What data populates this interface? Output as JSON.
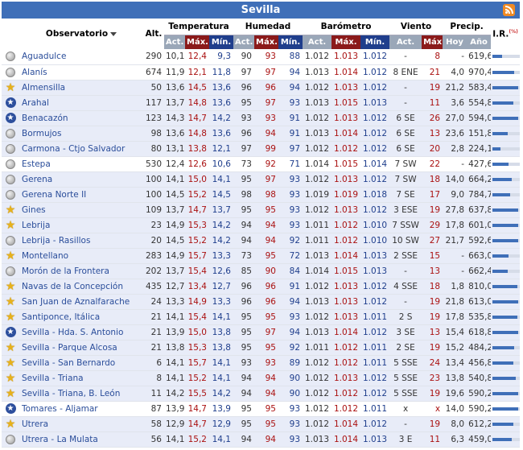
{
  "title": "Sevilla",
  "icons": {
    "rss": "rss-icon",
    "sort": "sort-down-icon"
  },
  "headers": {
    "observatorio": "Observatorio",
    "alt": "Alt.",
    "temperatura": "Temperatura",
    "humedad": "Humedad",
    "barometro": "Barómetro",
    "viento": "Viento",
    "precip": "Precip.",
    "ir": "I.R.",
    "ir_sup": "(%)",
    "act": "Act.",
    "max": "Máx.",
    "min": "Mín.",
    "hoy": "Hoy",
    "ano": "Año"
  },
  "colors": {
    "title_bg": "#3f6fb8",
    "max_text": "#a11111",
    "min_text": "#1f3e8c",
    "link": "#2a4d9a"
  },
  "rows": [
    {
      "icon": "circle",
      "name": "Aguadulce",
      "alt": "290",
      "t_act": "10,1",
      "t_max": "12,4",
      "t_min": "9,3",
      "h_act": "90",
      "h_max": "93",
      "h_min": "88",
      "b_act": "1.012",
      "b_max": "1.013",
      "b_min": "1.012",
      "w_act": "-",
      "w_max": "8",
      "p_hoy": "-",
      "p_ano": "619,6",
      "ir": 0.35
    },
    {
      "icon": "circle",
      "name": "Alanís",
      "alt": "674",
      "t_act": "11,9",
      "t_max": "12,1",
      "t_min": "11,8",
      "h_act": "97",
      "h_max": "97",
      "h_min": "94",
      "b_act": "1.013",
      "b_max": "1.014",
      "b_min": "1.012",
      "w_act": "8 ENE",
      "w_max": "21",
      "p_hoy": "4,0",
      "p_ano": "970,4",
      "ir": 0.8
    },
    {
      "icon": "star",
      "name": "Almensilla",
      "alt": "50",
      "t_act": "13,6",
      "t_max": "14,5",
      "t_min": "13,6",
      "h_act": "96",
      "h_max": "96",
      "h_min": "94",
      "b_act": "1.012",
      "b_max": "1.013",
      "b_min": "1.012",
      "w_act": "-",
      "w_max": "19",
      "p_hoy": "21,2",
      "p_ano": "583,4",
      "ir": 0.95
    },
    {
      "icon": "starblue",
      "name": "Arahal",
      "alt": "117",
      "t_act": "13,7",
      "t_max": "14,8",
      "t_min": "13,6",
      "h_act": "95",
      "h_max": "97",
      "h_min": "93",
      "b_act": "1.013",
      "b_max": "1.015",
      "b_min": "1.013",
      "w_act": "-",
      "w_max": "11",
      "p_hoy": "3,6",
      "p_ano": "554,8",
      "ir": 0.75
    },
    {
      "icon": "starblue",
      "name": "Benacazón",
      "alt": "123",
      "t_act": "14,3",
      "t_max": "14,7",
      "t_min": "14,2",
      "h_act": "93",
      "h_max": "93",
      "h_min": "91",
      "b_act": "1.012",
      "b_max": "1.013",
      "b_min": "1.012",
      "w_act": "6 SE",
      "w_max": "26",
      "p_hoy": "27,0",
      "p_ano": "594,0",
      "ir": 0.95
    },
    {
      "icon": "circle",
      "name": "Bormujos",
      "alt": "98",
      "t_act": "13,6",
      "t_max": "14,8",
      "t_min": "13,6",
      "h_act": "96",
      "h_max": "94",
      "h_min": "91",
      "b_act": "1.013",
      "b_max": "1.014",
      "b_min": "1.012",
      "w_act": "6 SE",
      "w_max": "13",
      "p_hoy": "23,6",
      "p_ano": "151,8",
      "ir": 0.55
    },
    {
      "icon": "circle",
      "name": "Carmona - Ctjo Salvador",
      "alt": "80",
      "t_act": "13,1",
      "t_max": "13,8",
      "t_min": "12,1",
      "h_act": "97",
      "h_max": "99",
      "h_min": "97",
      "b_act": "1.012",
      "b_max": "1.012",
      "b_min": "1.012",
      "w_act": "6 SE",
      "w_max": "20",
      "p_hoy": "2,8",
      "p_ano": "224,1",
      "ir": 0.3
    },
    {
      "icon": "circle",
      "name": "Estepa",
      "alt": "530",
      "t_act": "12,4",
      "t_max": "12,6",
      "t_min": "10,6",
      "h_act": "73",
      "h_max": "92",
      "h_min": "71",
      "b_act": "1.014",
      "b_max": "1.015",
      "b_min": "1.014",
      "w_act": "7 SW",
      "w_max": "22",
      "p_hoy": "-",
      "p_ano": "427,6",
      "ir": 0.6
    },
    {
      "icon": "circle",
      "name": "Gerena",
      "alt": "100",
      "t_act": "14,1",
      "t_max": "15,0",
      "t_min": "14,1",
      "h_act": "95",
      "h_max": "97",
      "h_min": "93",
      "b_act": "1.012",
      "b_max": "1.013",
      "b_min": "1.012",
      "w_act": "7 SW",
      "w_max": "18",
      "p_hoy": "14,0",
      "p_ano": "664,2",
      "ir": 0.7
    },
    {
      "icon": "circle",
      "name": "Gerena Norte II",
      "alt": "100",
      "t_act": "14,5",
      "t_max": "15,2",
      "t_min": "14,5",
      "h_act": "98",
      "h_max": "98",
      "h_min": "93",
      "b_act": "1.019",
      "b_max": "1.019",
      "b_min": "1.018",
      "w_act": "7 SE",
      "w_max": "17",
      "p_hoy": "9,0",
      "p_ano": "784,7",
      "ir": 0.65
    },
    {
      "icon": "star",
      "name": "Gines",
      "alt": "109",
      "t_act": "13,7",
      "t_max": "14,7",
      "t_min": "13,7",
      "h_act": "95",
      "h_max": "95",
      "h_min": "93",
      "b_act": "1.012",
      "b_max": "1.013",
      "b_min": "1.012",
      "w_act": "3 ESE",
      "w_max": "19",
      "p_hoy": "27,8",
      "p_ano": "637,8",
      "ir": 0.95
    },
    {
      "icon": "star",
      "name": "Lebrija",
      "alt": "23",
      "t_act": "14,9",
      "t_max": "15,3",
      "t_min": "14,2",
      "h_act": "94",
      "h_max": "94",
      "h_min": "93",
      "b_act": "1.011",
      "b_max": "1.012",
      "b_min": "1.010",
      "w_act": "7 SSW",
      "w_max": "29",
      "p_hoy": "17,8",
      "p_ano": "601,0",
      "ir": 0.95
    },
    {
      "icon": "circle",
      "name": "Lebrija - Rasillos",
      "alt": "20",
      "t_act": "14,5",
      "t_max": "15,2",
      "t_min": "14,2",
      "h_act": "94",
      "h_max": "94",
      "h_min": "92",
      "b_act": "1.011",
      "b_max": "1.012",
      "b_min": "1.010",
      "w_act": "10 SW",
      "w_max": "27",
      "p_hoy": "21,7",
      "p_ano": "592,6",
      "ir": 0.95
    },
    {
      "icon": "star",
      "name": "Montellano",
      "alt": "283",
      "t_act": "14,9",
      "t_max": "15,7",
      "t_min": "13,3",
      "h_act": "73",
      "h_max": "95",
      "h_min": "72",
      "b_act": "1.013",
      "b_max": "1.014",
      "b_min": "1.013",
      "w_act": "2 SSE",
      "w_max": "15",
      "p_hoy": "-",
      "p_ano": "663,0",
      "ir": 0.6
    },
    {
      "icon": "circle",
      "name": "Morón de la Frontera",
      "alt": "202",
      "t_act": "13,7",
      "t_max": "15,4",
      "t_min": "12,6",
      "h_act": "85",
      "h_max": "90",
      "h_min": "84",
      "b_act": "1.014",
      "b_max": "1.015",
      "b_min": "1.013",
      "w_act": "-",
      "w_max": "13",
      "p_hoy": "-",
      "p_ano": "662,4",
      "ir": 0.55
    },
    {
      "icon": "star",
      "name": "Navas de la Concepción",
      "alt": "435",
      "t_act": "12,7",
      "t_max": "13,4",
      "t_min": "12,7",
      "h_act": "96",
      "h_max": "96",
      "h_min": "91",
      "b_act": "1.012",
      "b_max": "1.013",
      "b_min": "1.012",
      "w_act": "4 SSE",
      "w_max": "18",
      "p_hoy": "1,8",
      "p_ano": "810,0",
      "ir": 0.9
    },
    {
      "icon": "star",
      "name": "San Juan de Aznalfarache",
      "alt": "24",
      "t_act": "13,3",
      "t_max": "14,9",
      "t_min": "13,3",
      "h_act": "96",
      "h_max": "96",
      "h_min": "94",
      "b_act": "1.013",
      "b_max": "1.013",
      "b_min": "1.012",
      "w_act": "-",
      "w_max": "19",
      "p_hoy": "21,8",
      "p_ano": "613,0",
      "ir": 0.95
    },
    {
      "icon": "star",
      "name": "Santiponce, Itálica",
      "alt": "21",
      "t_act": "14,1",
      "t_max": "15,4",
      "t_min": "14,1",
      "h_act": "95",
      "h_max": "95",
      "h_min": "93",
      "b_act": "1.012",
      "b_max": "1.013",
      "b_min": "1.011",
      "w_act": "2 S",
      "w_max": "19",
      "p_hoy": "17,8",
      "p_ano": "535,8",
      "ir": 0.9
    },
    {
      "icon": "starblue",
      "name": "Sevilla - Hda. S. Antonio",
      "alt": "21",
      "t_act": "13,9",
      "t_max": "15,0",
      "t_min": "13,8",
      "h_act": "95",
      "h_max": "97",
      "h_min": "94",
      "b_act": "1.013",
      "b_max": "1.014",
      "b_min": "1.012",
      "w_act": "3 SE",
      "w_max": "13",
      "p_hoy": "15,4",
      "p_ano": "618,8",
      "ir": 0.95
    },
    {
      "icon": "star",
      "name": "Sevilla - Parque Alcosa",
      "alt": "21",
      "t_act": "13,8",
      "t_max": "15,3",
      "t_min": "13,8",
      "h_act": "95",
      "h_max": "95",
      "h_min": "92",
      "b_act": "1.011",
      "b_max": "1.012",
      "b_min": "1.011",
      "w_act": "2 SE",
      "w_max": "19",
      "p_hoy": "15,2",
      "p_ano": "484,2",
      "ir": 0.8
    },
    {
      "icon": "star",
      "name": "Sevilla - San Bernardo",
      "alt": "6",
      "t_act": "14,1",
      "t_max": "15,7",
      "t_min": "14,1",
      "h_act": "93",
      "h_max": "93",
      "h_min": "89",
      "b_act": "1.012",
      "b_max": "1.012",
      "b_min": "1.011",
      "w_act": "5 SSE",
      "w_max": "24",
      "p_hoy": "13,4",
      "p_ano": "456,8",
      "ir": 0.75
    },
    {
      "icon": "star",
      "name": "Sevilla - Triana",
      "alt": "8",
      "t_act": "14,1",
      "t_max": "15,2",
      "t_min": "14,1",
      "h_act": "94",
      "h_max": "94",
      "h_min": "90",
      "b_act": "1.012",
      "b_max": "1.013",
      "b_min": "1.012",
      "w_act": "5 SSE",
      "w_max": "23",
      "p_hoy": "13,8",
      "p_ano": "540,8",
      "ir": 0.85
    },
    {
      "icon": "star",
      "name": "Sevilla - Triana, B. León",
      "alt": "11",
      "t_act": "14,2",
      "t_max": "15,5",
      "t_min": "14,2",
      "h_act": "94",
      "h_max": "94",
      "h_min": "90",
      "b_act": "1.012",
      "b_max": "1.012",
      "b_min": "1.012",
      "w_act": "5 SSE",
      "w_max": "19",
      "p_hoy": "19,6",
      "p_ano": "590,2",
      "ir": 0.95
    },
    {
      "icon": "starblue",
      "name": "Tomares - Aljamar",
      "alt": "87",
      "t_act": "13,9",
      "t_max": "14,7",
      "t_min": "13,9",
      "h_act": "95",
      "h_max": "95",
      "h_min": "93",
      "b_act": "1.012",
      "b_max": "1.012",
      "b_min": "1.011",
      "w_act": "x",
      "w_max": "x",
      "p_hoy": "14,0",
      "p_ano": "590,2",
      "ir": 0.95
    },
    {
      "icon": "star",
      "name": "Utrera",
      "alt": "58",
      "t_act": "12,9",
      "t_max": "14,7",
      "t_min": "12,9",
      "h_act": "95",
      "h_max": "95",
      "h_min": "93",
      "b_act": "1.012",
      "b_max": "1.014",
      "b_min": "1.012",
      "w_act": "-",
      "w_max": "19",
      "p_hoy": "8,0",
      "p_ano": "612,2",
      "ir": 0.75
    },
    {
      "icon": "circle",
      "name": "Utrera - La Mulata",
      "alt": "56",
      "t_act": "14,1",
      "t_max": "15,2",
      "t_min": "14,1",
      "h_act": "94",
      "h_max": "94",
      "h_min": "93",
      "b_act": "1.013",
      "b_max": "1.014",
      "b_min": "1.013",
      "w_act": "3 E",
      "w_max": "11",
      "p_hoy": "6,3",
      "p_ano": "459,0",
      "ir": 0.7
    }
  ]
}
